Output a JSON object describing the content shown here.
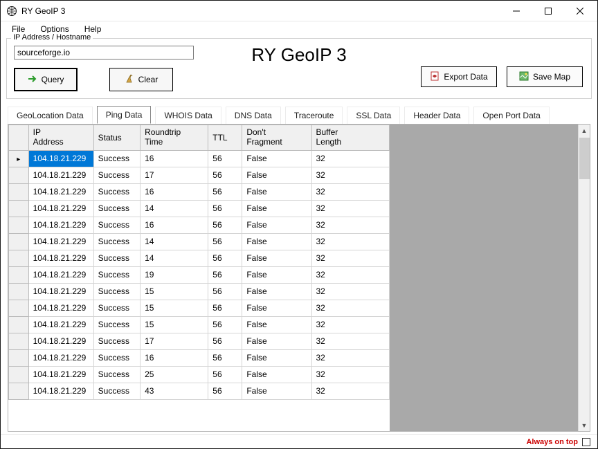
{
  "window": {
    "title": "RY GeoIP 3"
  },
  "menu": {
    "file": "File",
    "options": "Options",
    "help": "Help"
  },
  "fieldset": {
    "legend": "IP Address / Hostname",
    "host_value": "sourceforge.io"
  },
  "app_title": "RY GeoIP 3",
  "buttons": {
    "query": "Query",
    "clear": "Clear",
    "export": "Export Data",
    "savemap": "Save Map"
  },
  "tabs": [
    "GeoLocation Data",
    "Ping Data",
    "WHOIS Data",
    "DNS Data",
    "Traceroute",
    "SSL Data",
    "Header Data",
    "Open Port Data"
  ],
  "active_tab": 1,
  "grid": {
    "headers": {
      "ip": "IP Address",
      "status": "Status",
      "rt": "Roundtrip Time",
      "ttl": "TTL",
      "df": "Don't Fragment",
      "bl": "Buffer Length"
    },
    "selected_row": 0,
    "rows": [
      {
        "ip": "104.18.21.229",
        "status": "Success",
        "rt": "16",
        "ttl": "56",
        "df": "False",
        "bl": "32"
      },
      {
        "ip": "104.18.21.229",
        "status": "Success",
        "rt": "17",
        "ttl": "56",
        "df": "False",
        "bl": "32"
      },
      {
        "ip": "104.18.21.229",
        "status": "Success",
        "rt": "16",
        "ttl": "56",
        "df": "False",
        "bl": "32"
      },
      {
        "ip": "104.18.21.229",
        "status": "Success",
        "rt": "14",
        "ttl": "56",
        "df": "False",
        "bl": "32"
      },
      {
        "ip": "104.18.21.229",
        "status": "Success",
        "rt": "16",
        "ttl": "56",
        "df": "False",
        "bl": "32"
      },
      {
        "ip": "104.18.21.229",
        "status": "Success",
        "rt": "14",
        "ttl": "56",
        "df": "False",
        "bl": "32"
      },
      {
        "ip": "104.18.21.229",
        "status": "Success",
        "rt": "14",
        "ttl": "56",
        "df": "False",
        "bl": "32"
      },
      {
        "ip": "104.18.21.229",
        "status": "Success",
        "rt": "19",
        "ttl": "56",
        "df": "False",
        "bl": "32"
      },
      {
        "ip": "104.18.21.229",
        "status": "Success",
        "rt": "15",
        "ttl": "56",
        "df": "False",
        "bl": "32"
      },
      {
        "ip": "104.18.21.229",
        "status": "Success",
        "rt": "15",
        "ttl": "56",
        "df": "False",
        "bl": "32"
      },
      {
        "ip": "104.18.21.229",
        "status": "Success",
        "rt": "15",
        "ttl": "56",
        "df": "False",
        "bl": "32"
      },
      {
        "ip": "104.18.21.229",
        "status": "Success",
        "rt": "17",
        "ttl": "56",
        "df": "False",
        "bl": "32"
      },
      {
        "ip": "104.18.21.229",
        "status": "Success",
        "rt": "16",
        "ttl": "56",
        "df": "False",
        "bl": "32"
      },
      {
        "ip": "104.18.21.229",
        "status": "Success",
        "rt": "25",
        "ttl": "56",
        "df": "False",
        "bl": "32"
      },
      {
        "ip": "104.18.21.229",
        "status": "Success",
        "rt": "43",
        "ttl": "56",
        "df": "False",
        "bl": "32"
      }
    ]
  },
  "footer": {
    "always_on_top": "Always on top"
  }
}
